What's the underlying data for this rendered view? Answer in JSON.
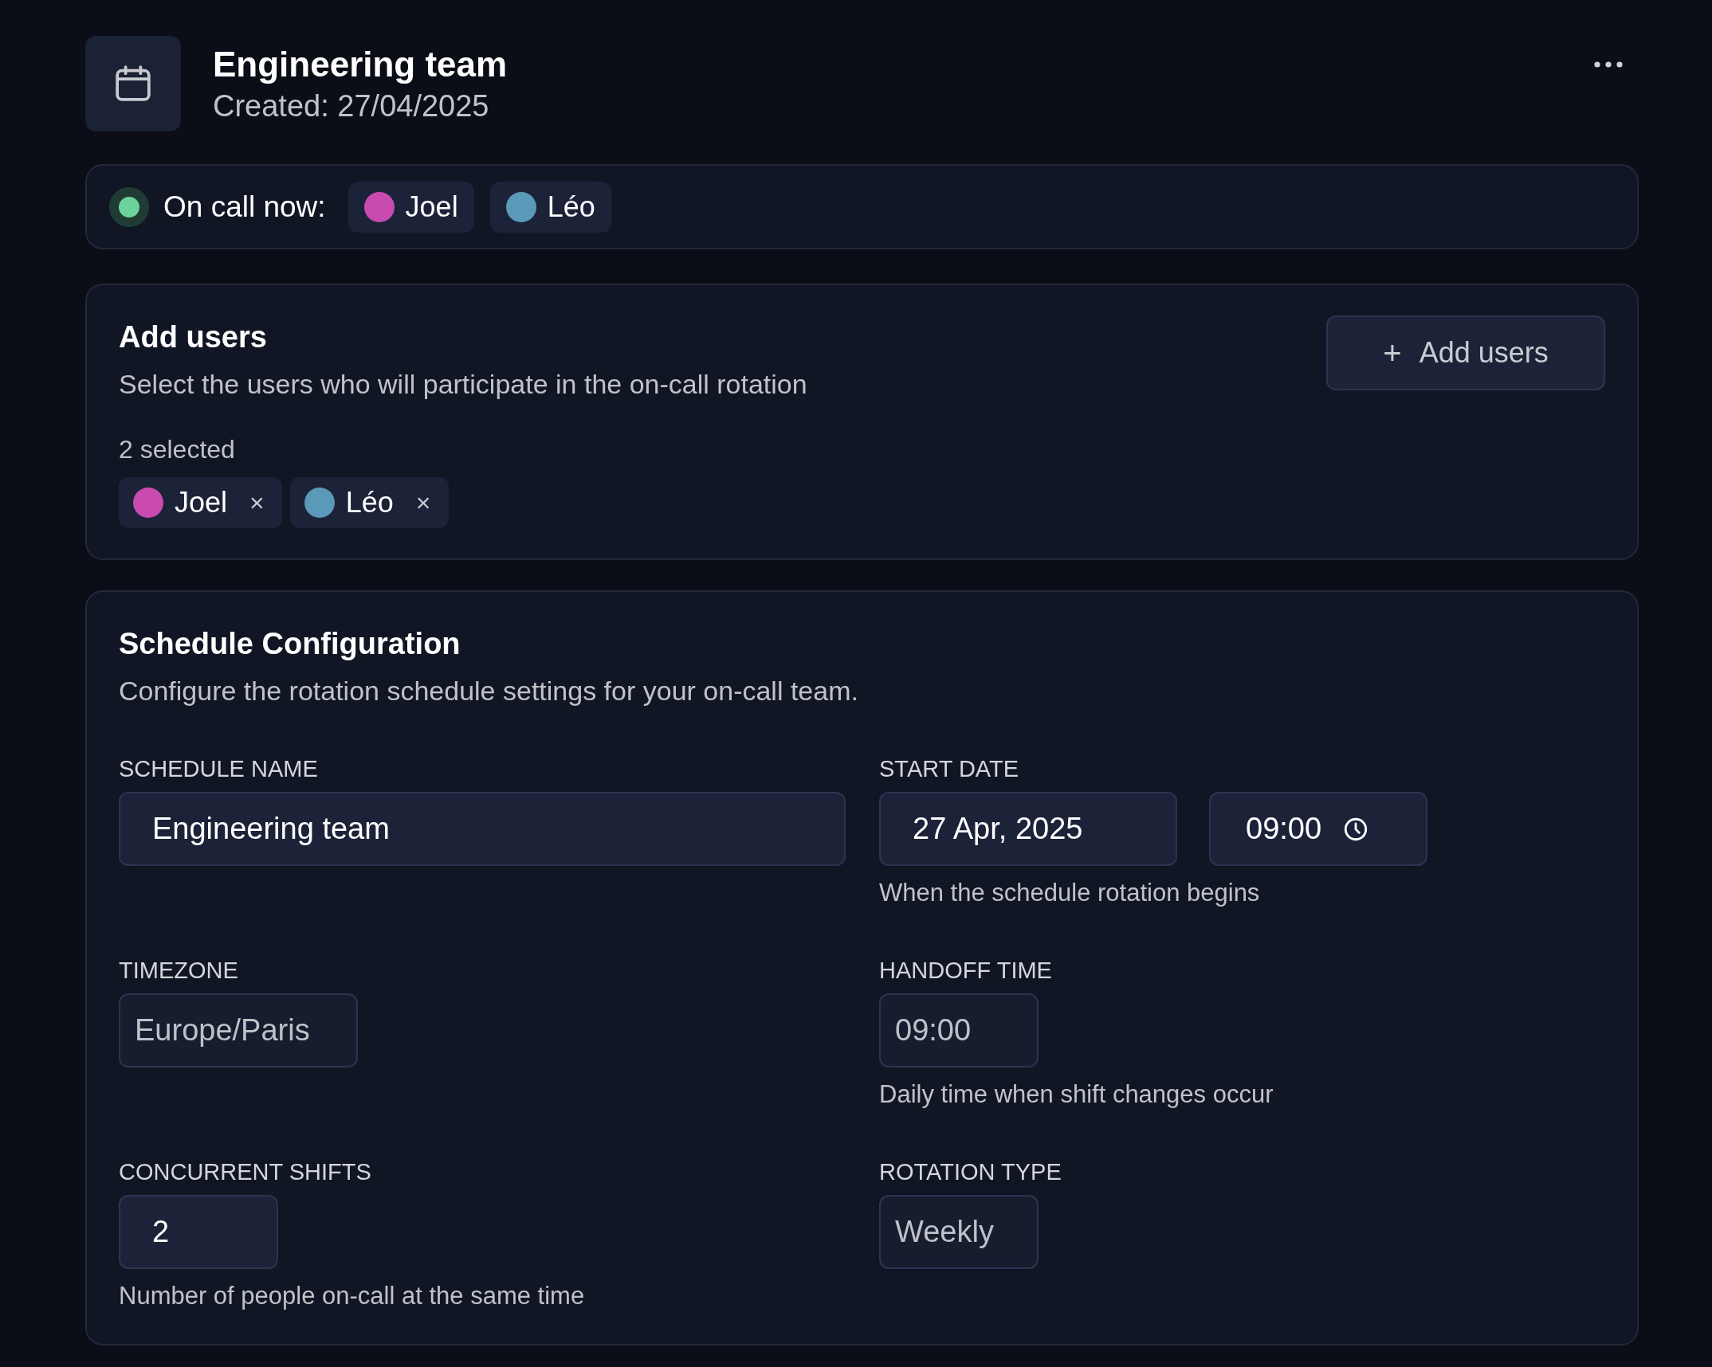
{
  "header": {
    "title": "Engineering team",
    "created": "Created: 27/04/2025"
  },
  "on_call": {
    "label": "On call now:",
    "active": true,
    "users": [
      {
        "name": "Joel",
        "color": "#c94bb0"
      },
      {
        "name": "Léo",
        "color": "#5a9ab8"
      }
    ]
  },
  "add_users": {
    "title": "Add users",
    "description": "Select the users who will participate in the on-call rotation",
    "button": {
      "icon": "+",
      "label": "Add users"
    },
    "count": "2 selected",
    "selected_users": [
      {
        "name": "Joel",
        "color": "#c94bb0",
        "remove": "×"
      },
      {
        "name": "Léo",
        "color": "#5a9ab8",
        "remove": "×"
      }
    ]
  },
  "schedule": {
    "title": "Schedule Configuration",
    "description": "Configure the rotation schedule settings for your on-call team.",
    "fields": [
      {
        "label": "SCHEDULE NAME",
        "inputs": [
          {
            "kind": "name",
            "value": "Engineering team",
            "disabled": false
          }
        ]
      },
      {
        "label": "START DATE",
        "inputs": [
          {
            "kind": "date",
            "value": "27 Apr, 2025",
            "disabled": false
          },
          {
            "kind": "time",
            "value": "09:00",
            "disabled": false
          }
        ],
        "help": "When the schedule rotation begins"
      },
      {
        "label": "TIMEZONE",
        "inputs": [
          {
            "kind": "zone",
            "value": "Europe/Paris",
            "disabled": true
          }
        ]
      },
      {
        "label": "HANDOFF TIME",
        "inputs": [
          {
            "kind": "short",
            "value": "09:00",
            "disabled": true
          }
        ],
        "help": "Daily time when shift changes occur"
      },
      {
        "label": "CONCURRENT SHIFTS",
        "inputs": [
          {
            "kind": "short",
            "value": "2",
            "disabled": false
          }
        ],
        "help": "Number of people on-call at the same time"
      },
      {
        "label": "ROTATION TYPE",
        "inputs": [
          {
            "kind": "short",
            "value": "Weekly",
            "disabled": true
          }
        ]
      }
    ]
  }
}
